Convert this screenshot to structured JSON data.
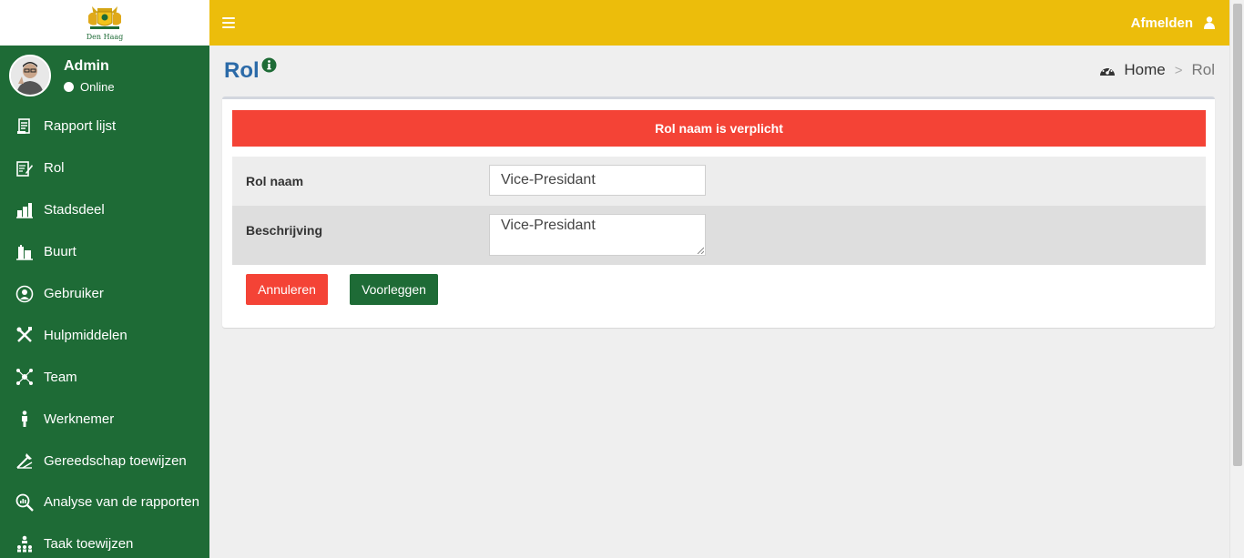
{
  "sidebar": {
    "logo_text": "Den Haag",
    "user": {
      "name": "Admin",
      "status": "Online"
    },
    "items": [
      {
        "label": "Rapport lijst",
        "icon": "report-list-icon"
      },
      {
        "label": "Rol",
        "icon": "role-edit-icon"
      },
      {
        "label": "Stadsdeel",
        "icon": "district-icon"
      },
      {
        "label": "Buurt",
        "icon": "neighborhood-icon"
      },
      {
        "label": "Gebruiker",
        "icon": "user-icon"
      },
      {
        "label": "Hulpmiddelen",
        "icon": "tools-icon"
      },
      {
        "label": "Team",
        "icon": "team-icon"
      },
      {
        "label": "Werknemer",
        "icon": "employee-icon"
      },
      {
        "label": "Gereedschap toewijzen",
        "icon": "assign-tools-icon"
      },
      {
        "label": "Analyse van de rapporten",
        "icon": "report-analysis-icon"
      },
      {
        "label": "Taak toewijzen",
        "icon": "assign-task-icon"
      }
    ]
  },
  "header": {
    "logout_label": "Afmelden"
  },
  "page": {
    "title": "Rol",
    "breadcrumb": {
      "home": "Home",
      "current": "Rol"
    }
  },
  "form": {
    "error_message": "Rol naam is verplicht",
    "name_label": "Rol naam",
    "name_value": "Vice-Presidant",
    "description_label": "Beschrijving",
    "description_value": "Vice-Presidant",
    "cancel_label": "Annuleren",
    "submit_label": "Voorleggen"
  },
  "colors": {
    "sidebar": "#1e6b36",
    "header": "#ecbd0b",
    "danger": "#f44336",
    "primary": "#1e6b36",
    "title": "#2b6aa8"
  }
}
